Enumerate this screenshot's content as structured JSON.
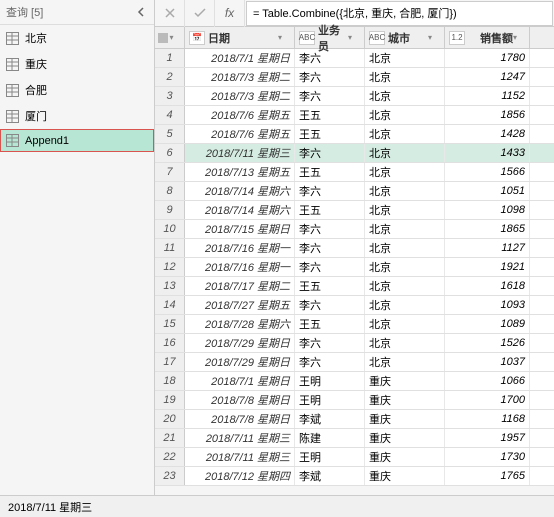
{
  "sidebar": {
    "title": "查询 [5]",
    "items": [
      {
        "label": "北京"
      },
      {
        "label": "重庆"
      },
      {
        "label": "合肥"
      },
      {
        "label": "厦门"
      },
      {
        "label": "Append1",
        "selected": true
      }
    ]
  },
  "formula": "= Table.Combine({北京, 重庆, 合肥, 厦门})",
  "columns": {
    "date": "日期",
    "sales": "业务员",
    "city": "城市",
    "amount": "销售额",
    "typeDate": "📅",
    "typeText": "ABC",
    "typeNum": "1.2"
  },
  "rows": [
    {
      "n": 1,
      "d": "2018/7/1 星期日",
      "s": "李六",
      "c": "北京",
      "a": 1780
    },
    {
      "n": 2,
      "d": "2018/7/3 星期二",
      "s": "李六",
      "c": "北京",
      "a": 1247
    },
    {
      "n": 3,
      "d": "2018/7/3 星期二",
      "s": "李六",
      "c": "北京",
      "a": 1152
    },
    {
      "n": 4,
      "d": "2018/7/6 星期五",
      "s": "王五",
      "c": "北京",
      "a": 1856
    },
    {
      "n": 5,
      "d": "2018/7/6 星期五",
      "s": "王五",
      "c": "北京",
      "a": 1428
    },
    {
      "n": 6,
      "d": "2018/7/11 星期三",
      "s": "李六",
      "c": "北京",
      "a": 1433,
      "sel": true
    },
    {
      "n": 7,
      "d": "2018/7/13 星期五",
      "s": "王五",
      "c": "北京",
      "a": 1566
    },
    {
      "n": 8,
      "d": "2018/7/14 星期六",
      "s": "李六",
      "c": "北京",
      "a": 1051
    },
    {
      "n": 9,
      "d": "2018/7/14 星期六",
      "s": "王五",
      "c": "北京",
      "a": 1098
    },
    {
      "n": 10,
      "d": "2018/7/15 星期日",
      "s": "李六",
      "c": "北京",
      "a": 1865
    },
    {
      "n": 11,
      "d": "2018/7/16 星期一",
      "s": "李六",
      "c": "北京",
      "a": 1127
    },
    {
      "n": 12,
      "d": "2018/7/16 星期一",
      "s": "李六",
      "c": "北京",
      "a": 1921
    },
    {
      "n": 13,
      "d": "2018/7/17 星期二",
      "s": "王五",
      "c": "北京",
      "a": 1618
    },
    {
      "n": 14,
      "d": "2018/7/27 星期五",
      "s": "李六",
      "c": "北京",
      "a": 1093
    },
    {
      "n": 15,
      "d": "2018/7/28 星期六",
      "s": "王五",
      "c": "北京",
      "a": 1089
    },
    {
      "n": 16,
      "d": "2018/7/29 星期日",
      "s": "李六",
      "c": "北京",
      "a": 1526
    },
    {
      "n": 17,
      "d": "2018/7/29 星期日",
      "s": "李六",
      "c": "北京",
      "a": 1037
    },
    {
      "n": 18,
      "d": "2018/7/1 星期日",
      "s": "王明",
      "c": "重庆",
      "a": 1066
    },
    {
      "n": 19,
      "d": "2018/7/8 星期日",
      "s": "王明",
      "c": "重庆",
      "a": 1700
    },
    {
      "n": 20,
      "d": "2018/7/8 星期日",
      "s": "李斌",
      "c": "重庆",
      "a": 1168
    },
    {
      "n": 21,
      "d": "2018/7/11 星期三",
      "s": "陈建",
      "c": "重庆",
      "a": 1957
    },
    {
      "n": 22,
      "d": "2018/7/11 星期三",
      "s": "王明",
      "c": "重庆",
      "a": 1730
    },
    {
      "n": 23,
      "d": "2018/7/12 星期四",
      "s": "李斌",
      "c": "重庆",
      "a": 1765
    }
  ],
  "status": "2018/7/11 星期三"
}
